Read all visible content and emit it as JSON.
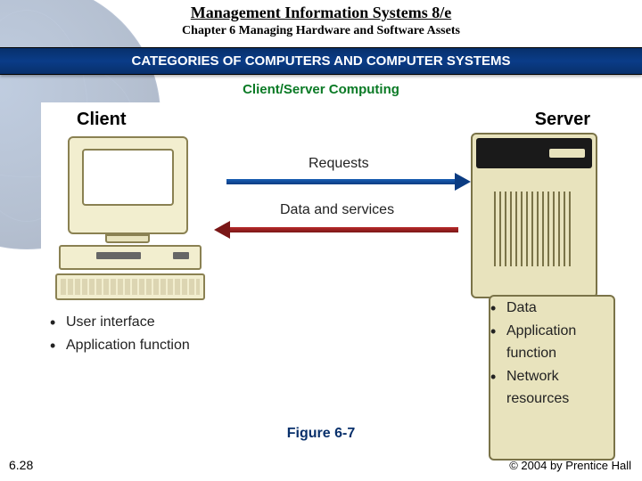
{
  "header": {
    "title": "Management Information Systems 8/e",
    "chapter": "Chapter 6 Managing Hardware and Software Assets"
  },
  "ribbon": "CATEGORIES OF COMPUTERS AND COMPUTER SYSTEMS",
  "subheading": "Client/Server Computing",
  "diagram": {
    "client_label": "Client",
    "server_label": "Server",
    "requests_label": "Requests",
    "data_services_label": "Data and services",
    "client_bullets": [
      "User interface",
      "Application function"
    ],
    "server_bullets": [
      "Data",
      "Application function",
      "Network resources"
    ]
  },
  "figure_label": "Figure 6-7",
  "slide_number": "6.28",
  "copyright": "© 2004 by Prentice Hall"
}
